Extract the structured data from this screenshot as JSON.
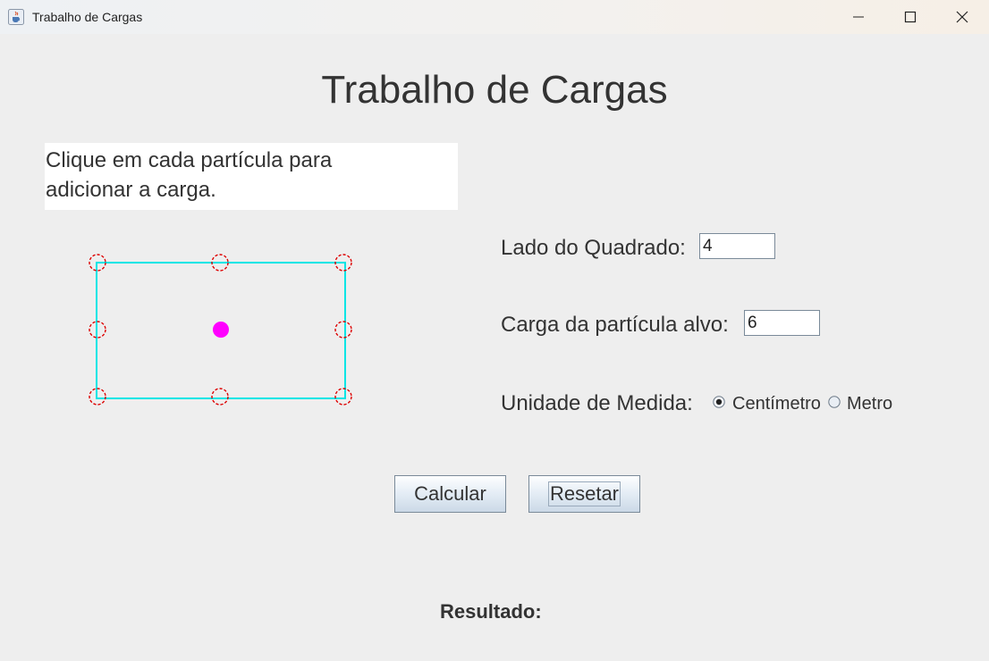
{
  "window": {
    "title": "Trabalho de Cargas",
    "icon": "java-cup-icon",
    "controls": [
      "minimize-icon",
      "maximize-icon",
      "close-icon"
    ]
  },
  "main": {
    "heading": "Trabalho de Cargas",
    "instructions_line1": "Clique em cada partícula para",
    "instructions_line2": "adicionar a carga."
  },
  "diagram": {
    "square_color": "#00e5e5",
    "particle_color": "#dd0000",
    "target_color": "#ff00ff",
    "particle_count": 8
  },
  "form": {
    "side_label": "Lado do Quadrado:",
    "side_value": "4",
    "charge_label": "Carga da partícula alvo:",
    "charge_value": "6",
    "unit_label": "Unidade de Medida:",
    "unit_options": [
      "Centímetro",
      "Metro"
    ],
    "unit_selected": "Centímetro"
  },
  "buttons": {
    "calculate": "Calcular",
    "reset": "Resetar"
  },
  "result": {
    "label": "Resultado:"
  }
}
